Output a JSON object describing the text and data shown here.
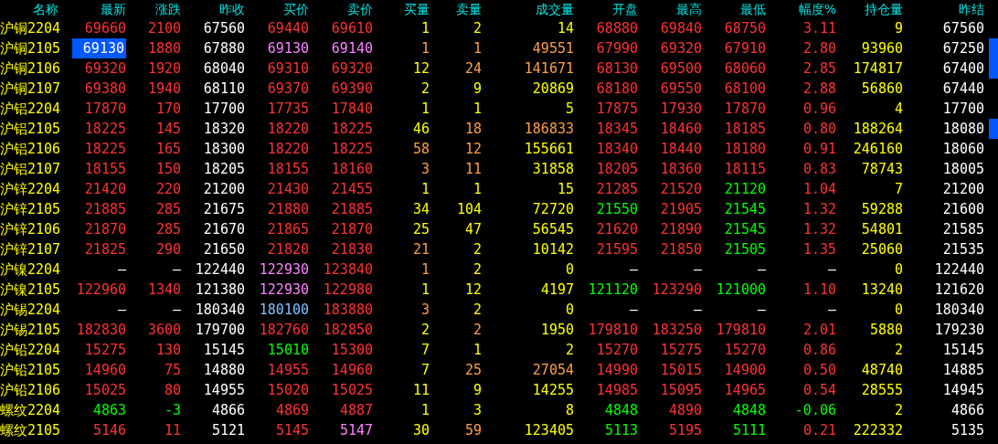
{
  "columns": [
    "名称",
    "最新",
    "涨跌",
    "昨收",
    "买价",
    "卖价",
    "买量",
    "卖量",
    "成交量",
    "开盘",
    "最高",
    "最低",
    "幅度%",
    "持仓量",
    "昨结"
  ],
  "rows": [
    {
      "selected": false,
      "marked": false,
      "cells": [
        {
          "text": "沪铜2204",
          "color": "#ffff00"
        },
        {
          "text": "69660",
          "color": "#ff3232"
        },
        {
          "text": "2100",
          "color": "#ff3232"
        },
        {
          "text": "67560",
          "color": "#ffffff"
        },
        {
          "text": "69440",
          "color": "#ff3232"
        },
        {
          "text": "69610",
          "color": "#ff3232"
        },
        {
          "text": "1",
          "color": "#ffff00"
        },
        {
          "text": "2",
          "color": "#ffff00"
        },
        {
          "text": "14",
          "color": "#ffff00"
        },
        {
          "text": "68880",
          "color": "#ff3232"
        },
        {
          "text": "69840",
          "color": "#ff3232"
        },
        {
          "text": "68750",
          "color": "#ff3232"
        },
        {
          "text": "3.11",
          "color": "#ff3232"
        },
        {
          "text": "9",
          "color": "#ffff00"
        },
        {
          "text": "67560",
          "color": "#ffffff"
        }
      ]
    },
    {
      "selected": true,
      "marked": true,
      "cells": [
        {
          "text": "沪铜2105",
          "color": "#ffff00"
        },
        {
          "text": "69130",
          "color": "#ffffff"
        },
        {
          "text": "1880",
          "color": "#ff3232"
        },
        {
          "text": "67880",
          "color": "#ffffff"
        },
        {
          "text": "69130",
          "color": "#ff80ff"
        },
        {
          "text": "69140",
          "color": "#ff80ff"
        },
        {
          "text": "1",
          "color": "#ffa040"
        },
        {
          "text": "1",
          "color": "#ffa040"
        },
        {
          "text": "49551",
          "color": "#ffa040"
        },
        {
          "text": "67990",
          "color": "#ff3232"
        },
        {
          "text": "69320",
          "color": "#ff3232"
        },
        {
          "text": "67910",
          "color": "#ff3232"
        },
        {
          "text": "2.80",
          "color": "#ff3232"
        },
        {
          "text": "93960",
          "color": "#ffff00"
        },
        {
          "text": "67250",
          "color": "#ffffff"
        }
      ]
    },
    {
      "selected": false,
      "marked": true,
      "cells": [
        {
          "text": "沪铜2106",
          "color": "#ffff00"
        },
        {
          "text": "69320",
          "color": "#ff3232"
        },
        {
          "text": "1920",
          "color": "#ff3232"
        },
        {
          "text": "68040",
          "color": "#ffffff"
        },
        {
          "text": "69310",
          "color": "#ff3232"
        },
        {
          "text": "69320",
          "color": "#ff3232"
        },
        {
          "text": "12",
          "color": "#ffff00"
        },
        {
          "text": "24",
          "color": "#ffa040"
        },
        {
          "text": "141671",
          "color": "#ffa040"
        },
        {
          "text": "68130",
          "color": "#ff3232"
        },
        {
          "text": "69500",
          "color": "#ff3232"
        },
        {
          "text": "68060",
          "color": "#ff3232"
        },
        {
          "text": "2.85",
          "color": "#ff3232"
        },
        {
          "text": "174817",
          "color": "#ffff00"
        },
        {
          "text": "67400",
          "color": "#ffffff"
        }
      ]
    },
    {
      "selected": false,
      "marked": false,
      "cells": [
        {
          "text": "沪铜2107",
          "color": "#ffff00"
        },
        {
          "text": "69380",
          "color": "#ff3232"
        },
        {
          "text": "1940",
          "color": "#ff3232"
        },
        {
          "text": "68110",
          "color": "#ffffff"
        },
        {
          "text": "69370",
          "color": "#ff3232"
        },
        {
          "text": "69390",
          "color": "#ff3232"
        },
        {
          "text": "2",
          "color": "#ffff00"
        },
        {
          "text": "9",
          "color": "#ffff00"
        },
        {
          "text": "20869",
          "color": "#ffff00"
        },
        {
          "text": "68180",
          "color": "#ff3232"
        },
        {
          "text": "69550",
          "color": "#ff3232"
        },
        {
          "text": "68100",
          "color": "#ff3232"
        },
        {
          "text": "2.88",
          "color": "#ff3232"
        },
        {
          "text": "56860",
          "color": "#ffff00"
        },
        {
          "text": "67440",
          "color": "#ffffff"
        }
      ]
    },
    {
      "selected": false,
      "marked": false,
      "cells": [
        {
          "text": "沪铝2204",
          "color": "#ffff00"
        },
        {
          "text": "17870",
          "color": "#ff3232"
        },
        {
          "text": "170",
          "color": "#ff3232"
        },
        {
          "text": "17700",
          "color": "#ffffff"
        },
        {
          "text": "17735",
          "color": "#ff3232"
        },
        {
          "text": "17840",
          "color": "#ff3232"
        },
        {
          "text": "1",
          "color": "#ffff00"
        },
        {
          "text": "1",
          "color": "#ffff00"
        },
        {
          "text": "5",
          "color": "#ffff00"
        },
        {
          "text": "17875",
          "color": "#ff3232"
        },
        {
          "text": "17930",
          "color": "#ff3232"
        },
        {
          "text": "17870",
          "color": "#ff3232"
        },
        {
          "text": "0.96",
          "color": "#ff3232"
        },
        {
          "text": "4",
          "color": "#ffff00"
        },
        {
          "text": "17700",
          "color": "#ffffff"
        }
      ]
    },
    {
      "selected": false,
      "marked": true,
      "cells": [
        {
          "text": "沪铝2105",
          "color": "#ffff00"
        },
        {
          "text": "18225",
          "color": "#ff3232"
        },
        {
          "text": "145",
          "color": "#ff3232"
        },
        {
          "text": "18320",
          "color": "#ffffff"
        },
        {
          "text": "18220",
          "color": "#ff3232"
        },
        {
          "text": "18225",
          "color": "#ff3232"
        },
        {
          "text": "46",
          "color": "#ffff00"
        },
        {
          "text": "18",
          "color": "#ffa040"
        },
        {
          "text": "186833",
          "color": "#ffa040"
        },
        {
          "text": "18345",
          "color": "#ff3232"
        },
        {
          "text": "18460",
          "color": "#ff3232"
        },
        {
          "text": "18185",
          "color": "#ff3232"
        },
        {
          "text": "0.80",
          "color": "#ff3232"
        },
        {
          "text": "188264",
          "color": "#ffff00"
        },
        {
          "text": "18080",
          "color": "#ffffff"
        }
      ]
    },
    {
      "selected": false,
      "marked": false,
      "cells": [
        {
          "text": "沪铝2106",
          "color": "#ffff00"
        },
        {
          "text": "18225",
          "color": "#ff3232"
        },
        {
          "text": "165",
          "color": "#ff3232"
        },
        {
          "text": "18300",
          "color": "#ffffff"
        },
        {
          "text": "18220",
          "color": "#ff3232"
        },
        {
          "text": "18225",
          "color": "#ff3232"
        },
        {
          "text": "58",
          "color": "#ffa040"
        },
        {
          "text": "12",
          "color": "#ffa040"
        },
        {
          "text": "155661",
          "color": "#ffff00"
        },
        {
          "text": "18340",
          "color": "#ff3232"
        },
        {
          "text": "18440",
          "color": "#ff3232"
        },
        {
          "text": "18180",
          "color": "#ff3232"
        },
        {
          "text": "0.91",
          "color": "#ff3232"
        },
        {
          "text": "246160",
          "color": "#ffff00"
        },
        {
          "text": "18060",
          "color": "#ffffff"
        }
      ]
    },
    {
      "selected": false,
      "marked": false,
      "cells": [
        {
          "text": "沪铝2107",
          "color": "#ffff00"
        },
        {
          "text": "18155",
          "color": "#ff3232"
        },
        {
          "text": "150",
          "color": "#ff3232"
        },
        {
          "text": "18205",
          "color": "#ffffff"
        },
        {
          "text": "18155",
          "color": "#ff3232"
        },
        {
          "text": "18160",
          "color": "#ff3232"
        },
        {
          "text": "3",
          "color": "#ffa040"
        },
        {
          "text": "11",
          "color": "#ffa040"
        },
        {
          "text": "31858",
          "color": "#ffff00"
        },
        {
          "text": "18205",
          "color": "#ff3232"
        },
        {
          "text": "18360",
          "color": "#ff3232"
        },
        {
          "text": "18115",
          "color": "#ff3232"
        },
        {
          "text": "0.83",
          "color": "#ff3232"
        },
        {
          "text": "78743",
          "color": "#ffff00"
        },
        {
          "text": "18005",
          "color": "#ffffff"
        }
      ]
    },
    {
      "selected": false,
      "marked": false,
      "cells": [
        {
          "text": "沪锌2204",
          "color": "#ffff00"
        },
        {
          "text": "21420",
          "color": "#ff3232"
        },
        {
          "text": "220",
          "color": "#ff3232"
        },
        {
          "text": "21200",
          "color": "#ffffff"
        },
        {
          "text": "21430",
          "color": "#ff3232"
        },
        {
          "text": "21455",
          "color": "#ff3232"
        },
        {
          "text": "1",
          "color": "#ffff00"
        },
        {
          "text": "1",
          "color": "#ffff00"
        },
        {
          "text": "15",
          "color": "#ffff00"
        },
        {
          "text": "21285",
          "color": "#ff3232"
        },
        {
          "text": "21520",
          "color": "#ff3232"
        },
        {
          "text": "21120",
          "color": "#00ff00"
        },
        {
          "text": "1.04",
          "color": "#ff3232"
        },
        {
          "text": "7",
          "color": "#ffff00"
        },
        {
          "text": "21200",
          "color": "#ffffff"
        }
      ]
    },
    {
      "selected": false,
      "marked": false,
      "cells": [
        {
          "text": "沪锌2105",
          "color": "#ffff00"
        },
        {
          "text": "21885",
          "color": "#ff3232"
        },
        {
          "text": "285",
          "color": "#ff3232"
        },
        {
          "text": "21675",
          "color": "#ffffff"
        },
        {
          "text": "21880",
          "color": "#ff3232"
        },
        {
          "text": "21885",
          "color": "#ff3232"
        },
        {
          "text": "34",
          "color": "#ffff00"
        },
        {
          "text": "104",
          "color": "#ffff00"
        },
        {
          "text": "72720",
          "color": "#ffff00"
        },
        {
          "text": "21550",
          "color": "#00ff00"
        },
        {
          "text": "21905",
          "color": "#ff3232"
        },
        {
          "text": "21545",
          "color": "#00ff00"
        },
        {
          "text": "1.32",
          "color": "#ff3232"
        },
        {
          "text": "59288",
          "color": "#ffff00"
        },
        {
          "text": "21600",
          "color": "#ffffff"
        }
      ]
    },
    {
      "selected": false,
      "marked": false,
      "cells": [
        {
          "text": "沪锌2106",
          "color": "#ffff00"
        },
        {
          "text": "21870",
          "color": "#ff3232"
        },
        {
          "text": "285",
          "color": "#ff3232"
        },
        {
          "text": "21670",
          "color": "#ffffff"
        },
        {
          "text": "21865",
          "color": "#ff3232"
        },
        {
          "text": "21870",
          "color": "#ff3232"
        },
        {
          "text": "25",
          "color": "#ffff00"
        },
        {
          "text": "47",
          "color": "#ffff00"
        },
        {
          "text": "56545",
          "color": "#ffff00"
        },
        {
          "text": "21620",
          "color": "#ff3232"
        },
        {
          "text": "21890",
          "color": "#ff3232"
        },
        {
          "text": "21545",
          "color": "#00ff00"
        },
        {
          "text": "1.32",
          "color": "#ff3232"
        },
        {
          "text": "54801",
          "color": "#ffff00"
        },
        {
          "text": "21585",
          "color": "#ffffff"
        }
      ]
    },
    {
      "selected": false,
      "marked": false,
      "cells": [
        {
          "text": "沪锌2107",
          "color": "#ffff00"
        },
        {
          "text": "21825",
          "color": "#ff3232"
        },
        {
          "text": "290",
          "color": "#ff3232"
        },
        {
          "text": "21650",
          "color": "#ffffff"
        },
        {
          "text": "21820",
          "color": "#ff3232"
        },
        {
          "text": "21830",
          "color": "#ff3232"
        },
        {
          "text": "21",
          "color": "#ffa040"
        },
        {
          "text": "2",
          "color": "#ffff00"
        },
        {
          "text": "10142",
          "color": "#ffff00"
        },
        {
          "text": "21595",
          "color": "#ff3232"
        },
        {
          "text": "21850",
          "color": "#ff3232"
        },
        {
          "text": "21505",
          "color": "#00ff00"
        },
        {
          "text": "1.35",
          "color": "#ff3232"
        },
        {
          "text": "25060",
          "color": "#ffff00"
        },
        {
          "text": "21535",
          "color": "#ffffff"
        }
      ]
    },
    {
      "selected": false,
      "marked": false,
      "cells": [
        {
          "text": "沪镍2204",
          "color": "#ffff00"
        },
        {
          "text": "—",
          "color": "#ffffff"
        },
        {
          "text": "—",
          "color": "#ffffff"
        },
        {
          "text": "122440",
          "color": "#ffffff"
        },
        {
          "text": "122930",
          "color": "#ff80ff"
        },
        {
          "text": "123840",
          "color": "#ff3232"
        },
        {
          "text": "1",
          "color": "#ffa040"
        },
        {
          "text": "2",
          "color": "#ffff00"
        },
        {
          "text": "0",
          "color": "#ffff00"
        },
        {
          "text": "—",
          "color": "#ffffff"
        },
        {
          "text": "—",
          "color": "#ffffff"
        },
        {
          "text": "—",
          "color": "#ffffff"
        },
        {
          "text": "—",
          "color": "#ffffff"
        },
        {
          "text": "0",
          "color": "#ffff00"
        },
        {
          "text": "122440",
          "color": "#ffffff"
        }
      ]
    },
    {
      "selected": false,
      "marked": false,
      "cells": [
        {
          "text": "沪镍2105",
          "color": "#ffff00"
        },
        {
          "text": "122960",
          "color": "#ff3232"
        },
        {
          "text": "1340",
          "color": "#ff3232"
        },
        {
          "text": "121380",
          "color": "#ffffff"
        },
        {
          "text": "122930",
          "color": "#ff80ff"
        },
        {
          "text": "122980",
          "color": "#ff3232"
        },
        {
          "text": "1",
          "color": "#ffff00"
        },
        {
          "text": "12",
          "color": "#ffff00"
        },
        {
          "text": "4197",
          "color": "#ffff00"
        },
        {
          "text": "121120",
          "color": "#00ff00"
        },
        {
          "text": "123290",
          "color": "#ff3232"
        },
        {
          "text": "121000",
          "color": "#00ff00"
        },
        {
          "text": "1.10",
          "color": "#ff3232"
        },
        {
          "text": "13240",
          "color": "#ffff00"
        },
        {
          "text": "121620",
          "color": "#ffffff"
        }
      ]
    },
    {
      "selected": false,
      "marked": false,
      "cells": [
        {
          "text": "沪锡2204",
          "color": "#ffff00"
        },
        {
          "text": "—",
          "color": "#ffffff"
        },
        {
          "text": "—",
          "color": "#ffffff"
        },
        {
          "text": "180340",
          "color": "#ffffff"
        },
        {
          "text": "180100",
          "color": "#80c0ff"
        },
        {
          "text": "183880",
          "color": "#ff3232"
        },
        {
          "text": "3",
          "color": "#ffa040"
        },
        {
          "text": "2",
          "color": "#ffff00"
        },
        {
          "text": "0",
          "color": "#ffff00"
        },
        {
          "text": "—",
          "color": "#ffffff"
        },
        {
          "text": "—",
          "color": "#ffffff"
        },
        {
          "text": "—",
          "color": "#ffffff"
        },
        {
          "text": "—",
          "color": "#ffffff"
        },
        {
          "text": "0",
          "color": "#ffff00"
        },
        {
          "text": "180340",
          "color": "#ffffff"
        }
      ]
    },
    {
      "selected": false,
      "marked": false,
      "cells": [
        {
          "text": "沪锡2105",
          "color": "#ffff00"
        },
        {
          "text": "182830",
          "color": "#ff3232"
        },
        {
          "text": "3600",
          "color": "#ff3232"
        },
        {
          "text": "179700",
          "color": "#ffffff"
        },
        {
          "text": "182760",
          "color": "#ff3232"
        },
        {
          "text": "182850",
          "color": "#ff3232"
        },
        {
          "text": "2",
          "color": "#ffff00"
        },
        {
          "text": "2",
          "color": "#ffa040"
        },
        {
          "text": "1950",
          "color": "#ffff00"
        },
        {
          "text": "179810",
          "color": "#ff3232"
        },
        {
          "text": "183250",
          "color": "#ff3232"
        },
        {
          "text": "179810",
          "color": "#ff3232"
        },
        {
          "text": "2.01",
          "color": "#ff3232"
        },
        {
          "text": "5880",
          "color": "#ffff00"
        },
        {
          "text": "179230",
          "color": "#ffffff"
        }
      ]
    },
    {
      "selected": false,
      "marked": false,
      "cells": [
        {
          "text": "沪铅2204",
          "color": "#ffff00"
        },
        {
          "text": "15275",
          "color": "#ff3232"
        },
        {
          "text": "130",
          "color": "#ff3232"
        },
        {
          "text": "15145",
          "color": "#ffffff"
        },
        {
          "text": "15010",
          "color": "#00ff00"
        },
        {
          "text": "15300",
          "color": "#ff3232"
        },
        {
          "text": "7",
          "color": "#ffff00"
        },
        {
          "text": "1",
          "color": "#ffff00"
        },
        {
          "text": "2",
          "color": "#ffff00"
        },
        {
          "text": "15270",
          "color": "#ff3232"
        },
        {
          "text": "15275",
          "color": "#ff3232"
        },
        {
          "text": "15270",
          "color": "#ff3232"
        },
        {
          "text": "0.86",
          "color": "#ff3232"
        },
        {
          "text": "2",
          "color": "#ffff00"
        },
        {
          "text": "15145",
          "color": "#ffffff"
        }
      ]
    },
    {
      "selected": false,
      "marked": false,
      "cells": [
        {
          "text": "沪铅2105",
          "color": "#ffff00"
        },
        {
          "text": "14960",
          "color": "#ff3232"
        },
        {
          "text": "75",
          "color": "#ff3232"
        },
        {
          "text": "14880",
          "color": "#ffffff"
        },
        {
          "text": "14955",
          "color": "#ff3232"
        },
        {
          "text": "14960",
          "color": "#ff3232"
        },
        {
          "text": "7",
          "color": "#ffff00"
        },
        {
          "text": "25",
          "color": "#ffa040"
        },
        {
          "text": "27054",
          "color": "#ffa040"
        },
        {
          "text": "14990",
          "color": "#ff3232"
        },
        {
          "text": "15015",
          "color": "#ff3232"
        },
        {
          "text": "14900",
          "color": "#ff3232"
        },
        {
          "text": "0.50",
          "color": "#ff3232"
        },
        {
          "text": "48740",
          "color": "#ffff00"
        },
        {
          "text": "14885",
          "color": "#ffffff"
        }
      ]
    },
    {
      "selected": false,
      "marked": false,
      "cells": [
        {
          "text": "沪铅2106",
          "color": "#ffff00"
        },
        {
          "text": "15025",
          "color": "#ff3232"
        },
        {
          "text": "80",
          "color": "#ff3232"
        },
        {
          "text": "14955",
          "color": "#ffffff"
        },
        {
          "text": "15020",
          "color": "#ff3232"
        },
        {
          "text": "15025",
          "color": "#ff3232"
        },
        {
          "text": "11",
          "color": "#ffff00"
        },
        {
          "text": "9",
          "color": "#ffff00"
        },
        {
          "text": "14255",
          "color": "#ffff00"
        },
        {
          "text": "14985",
          "color": "#ff3232"
        },
        {
          "text": "15095",
          "color": "#ff3232"
        },
        {
          "text": "14965",
          "color": "#ff3232"
        },
        {
          "text": "0.54",
          "color": "#ff3232"
        },
        {
          "text": "28555",
          "color": "#ffff00"
        },
        {
          "text": "14945",
          "color": "#ffffff"
        }
      ]
    },
    {
      "selected": false,
      "marked": false,
      "cells": [
        {
          "text": "螺纹2204",
          "color": "#ffff00"
        },
        {
          "text": "4863",
          "color": "#00ff00"
        },
        {
          "text": "-3",
          "color": "#00ff00"
        },
        {
          "text": "4866",
          "color": "#ffffff"
        },
        {
          "text": "4869",
          "color": "#ff3232"
        },
        {
          "text": "4887",
          "color": "#ff3232"
        },
        {
          "text": "1",
          "color": "#ffff00"
        },
        {
          "text": "3",
          "color": "#ffff00"
        },
        {
          "text": "8",
          "color": "#ffff00"
        },
        {
          "text": "4848",
          "color": "#00ff00"
        },
        {
          "text": "4890",
          "color": "#ff3232"
        },
        {
          "text": "4848",
          "color": "#00ff00"
        },
        {
          "text": "-0.06",
          "color": "#00ff00"
        },
        {
          "text": "2",
          "color": "#ffff00"
        },
        {
          "text": "4866",
          "color": "#ffffff"
        }
      ]
    },
    {
      "selected": false,
      "marked": false,
      "cells": [
        {
          "text": "螺纹2105",
          "color": "#ffff00"
        },
        {
          "text": "5146",
          "color": "#ff3232"
        },
        {
          "text": "11",
          "color": "#ff3232"
        },
        {
          "text": "5121",
          "color": "#ffffff"
        },
        {
          "text": "5145",
          "color": "#ff3232"
        },
        {
          "text": "5147",
          "color": "#ff80ff"
        },
        {
          "text": "30",
          "color": "#ffff00"
        },
        {
          "text": "59",
          "color": "#ffa040"
        },
        {
          "text": "123405",
          "color": "#ffff00"
        },
        {
          "text": "5113",
          "color": "#00ff00"
        },
        {
          "text": "5195",
          "color": "#ff3232"
        },
        {
          "text": "5111",
          "color": "#00ff00"
        },
        {
          "text": "0.21",
          "color": "#ff3232"
        },
        {
          "text": "222332",
          "color": "#ffff00"
        },
        {
          "text": "5135",
          "color": "#ffffff"
        }
      ]
    }
  ]
}
